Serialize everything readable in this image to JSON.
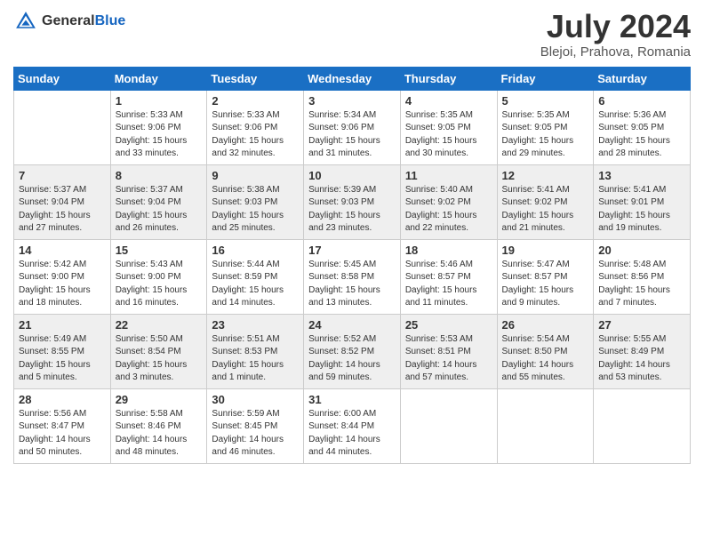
{
  "header": {
    "logo_general": "General",
    "logo_blue": "Blue",
    "month_year": "July 2024",
    "location": "Blejoi, Prahova, Romania"
  },
  "weekdays": [
    "Sunday",
    "Monday",
    "Tuesday",
    "Wednesday",
    "Thursday",
    "Friday",
    "Saturday"
  ],
  "weeks": [
    [
      {
        "day": "",
        "info": ""
      },
      {
        "day": "1",
        "info": "Sunrise: 5:33 AM\nSunset: 9:06 PM\nDaylight: 15 hours\nand 33 minutes."
      },
      {
        "day": "2",
        "info": "Sunrise: 5:33 AM\nSunset: 9:06 PM\nDaylight: 15 hours\nand 32 minutes."
      },
      {
        "day": "3",
        "info": "Sunrise: 5:34 AM\nSunset: 9:06 PM\nDaylight: 15 hours\nand 31 minutes."
      },
      {
        "day": "4",
        "info": "Sunrise: 5:35 AM\nSunset: 9:05 PM\nDaylight: 15 hours\nand 30 minutes."
      },
      {
        "day": "5",
        "info": "Sunrise: 5:35 AM\nSunset: 9:05 PM\nDaylight: 15 hours\nand 29 minutes."
      },
      {
        "day": "6",
        "info": "Sunrise: 5:36 AM\nSunset: 9:05 PM\nDaylight: 15 hours\nand 28 minutes."
      }
    ],
    [
      {
        "day": "7",
        "info": "Sunrise: 5:37 AM\nSunset: 9:04 PM\nDaylight: 15 hours\nand 27 minutes."
      },
      {
        "day": "8",
        "info": "Sunrise: 5:37 AM\nSunset: 9:04 PM\nDaylight: 15 hours\nand 26 minutes."
      },
      {
        "day": "9",
        "info": "Sunrise: 5:38 AM\nSunset: 9:03 PM\nDaylight: 15 hours\nand 25 minutes."
      },
      {
        "day": "10",
        "info": "Sunrise: 5:39 AM\nSunset: 9:03 PM\nDaylight: 15 hours\nand 23 minutes."
      },
      {
        "day": "11",
        "info": "Sunrise: 5:40 AM\nSunset: 9:02 PM\nDaylight: 15 hours\nand 22 minutes."
      },
      {
        "day": "12",
        "info": "Sunrise: 5:41 AM\nSunset: 9:02 PM\nDaylight: 15 hours\nand 21 minutes."
      },
      {
        "day": "13",
        "info": "Sunrise: 5:41 AM\nSunset: 9:01 PM\nDaylight: 15 hours\nand 19 minutes."
      }
    ],
    [
      {
        "day": "14",
        "info": "Sunrise: 5:42 AM\nSunset: 9:00 PM\nDaylight: 15 hours\nand 18 minutes."
      },
      {
        "day": "15",
        "info": "Sunrise: 5:43 AM\nSunset: 9:00 PM\nDaylight: 15 hours\nand 16 minutes."
      },
      {
        "day": "16",
        "info": "Sunrise: 5:44 AM\nSunset: 8:59 PM\nDaylight: 15 hours\nand 14 minutes."
      },
      {
        "day": "17",
        "info": "Sunrise: 5:45 AM\nSunset: 8:58 PM\nDaylight: 15 hours\nand 13 minutes."
      },
      {
        "day": "18",
        "info": "Sunrise: 5:46 AM\nSunset: 8:57 PM\nDaylight: 15 hours\nand 11 minutes."
      },
      {
        "day": "19",
        "info": "Sunrise: 5:47 AM\nSunset: 8:57 PM\nDaylight: 15 hours\nand 9 minutes."
      },
      {
        "day": "20",
        "info": "Sunrise: 5:48 AM\nSunset: 8:56 PM\nDaylight: 15 hours\nand 7 minutes."
      }
    ],
    [
      {
        "day": "21",
        "info": "Sunrise: 5:49 AM\nSunset: 8:55 PM\nDaylight: 15 hours\nand 5 minutes."
      },
      {
        "day": "22",
        "info": "Sunrise: 5:50 AM\nSunset: 8:54 PM\nDaylight: 15 hours\nand 3 minutes."
      },
      {
        "day": "23",
        "info": "Sunrise: 5:51 AM\nSunset: 8:53 PM\nDaylight: 15 hours\nand 1 minute."
      },
      {
        "day": "24",
        "info": "Sunrise: 5:52 AM\nSunset: 8:52 PM\nDaylight: 14 hours\nand 59 minutes."
      },
      {
        "day": "25",
        "info": "Sunrise: 5:53 AM\nSunset: 8:51 PM\nDaylight: 14 hours\nand 57 minutes."
      },
      {
        "day": "26",
        "info": "Sunrise: 5:54 AM\nSunset: 8:50 PM\nDaylight: 14 hours\nand 55 minutes."
      },
      {
        "day": "27",
        "info": "Sunrise: 5:55 AM\nSunset: 8:49 PM\nDaylight: 14 hours\nand 53 minutes."
      }
    ],
    [
      {
        "day": "28",
        "info": "Sunrise: 5:56 AM\nSunset: 8:47 PM\nDaylight: 14 hours\nand 50 minutes."
      },
      {
        "day": "29",
        "info": "Sunrise: 5:58 AM\nSunset: 8:46 PM\nDaylight: 14 hours\nand 48 minutes."
      },
      {
        "day": "30",
        "info": "Sunrise: 5:59 AM\nSunset: 8:45 PM\nDaylight: 14 hours\nand 46 minutes."
      },
      {
        "day": "31",
        "info": "Sunrise: 6:00 AM\nSunset: 8:44 PM\nDaylight: 14 hours\nand 44 minutes."
      },
      {
        "day": "",
        "info": ""
      },
      {
        "day": "",
        "info": ""
      },
      {
        "day": "",
        "info": ""
      }
    ]
  ]
}
